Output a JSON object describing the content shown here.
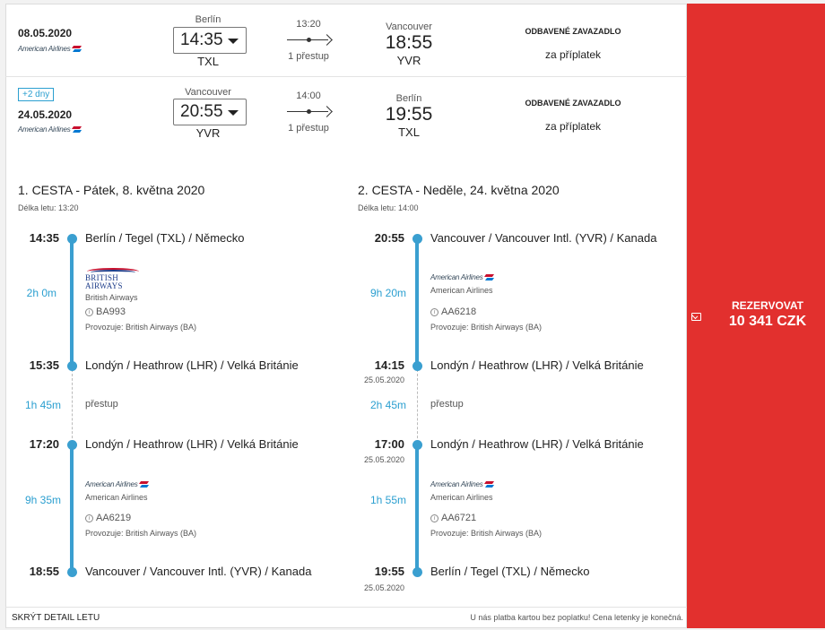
{
  "outbound": {
    "date": "08.05.2020",
    "airline_logo": "American Airlines",
    "from_city": "Berlín",
    "dep_time": "14:35",
    "from_code": "TXL",
    "duration": "13:20",
    "stops": "1 přestup",
    "to_city": "Vancouver",
    "arr_time": "18:55",
    "to_code": "YVR",
    "baggage": "ODBAVENÉ ZAVAZADLO",
    "fee": "za příplatek"
  },
  "inbound": {
    "badge": "+2 dny",
    "date": "24.05.2020",
    "airline_logo": "American Airlines",
    "from_city": "Vancouver",
    "dep_time": "20:55",
    "from_code": "YVR",
    "duration": "14:00",
    "stops": "1 přestup",
    "to_city": "Berlín",
    "arr_time": "19:55",
    "to_code": "TXL",
    "baggage": "ODBAVENÉ ZAVAZADLO",
    "fee": "za příplatek"
  },
  "price": {
    "label": "REZERVOVAT",
    "amount": "10 341 CZK"
  },
  "leg1": {
    "title": "1. CESTA - Pátek, 8. května 2020",
    "length": "Délka letu: 13:20",
    "stops": [
      {
        "time": "14:35",
        "place": "Berlín / Tegel (TXL) / Německo"
      },
      {
        "time": "15:35",
        "place": "Londýn / Heathrow (LHR) / Velká Británie"
      },
      {
        "time": "17:20",
        "place": "Londýn / Heathrow (LHR) / Velká Británie"
      },
      {
        "time": "18:55",
        "place": "Vancouver / Vancouver Intl. (YVR) / Kanada"
      }
    ],
    "seg1": {
      "duration": "2h 0m",
      "logo_line1": "BRITISH",
      "logo_line2": "AIRWAYS",
      "carrier": "British Airways",
      "flight": "BA993",
      "operated": "Provozuje: British Airways (BA)"
    },
    "transfer": {
      "duration": "1h 45m",
      "label": "přestup"
    },
    "seg2": {
      "duration": "9h 35m",
      "logo": "American Airlines",
      "carrier": "American Airlines",
      "flight": "AA6219",
      "operated": "Provozuje: British Airways (BA)"
    }
  },
  "leg2": {
    "title": "2. CESTA - Neděle, 24. května 2020",
    "length": "Délka letu: 14:00",
    "stops": [
      {
        "time": "20:55",
        "place": "Vancouver / Vancouver Intl. (YVR) / Kanada",
        "date": ""
      },
      {
        "time": "14:15",
        "place": "Londýn / Heathrow (LHR) / Velká Británie",
        "date": "25.05.2020"
      },
      {
        "time": "17:00",
        "place": "Londýn / Heathrow (LHR) / Velká Británie",
        "date": "25.05.2020"
      },
      {
        "time": "19:55",
        "place": "Berlín / Tegel (TXL) / Německo",
        "date": "25.05.2020"
      }
    ],
    "seg1": {
      "duration": "9h 20m",
      "logo": "American Airlines",
      "carrier": "American Airlines",
      "flight": "AA6218",
      "operated": "Provozuje: British Airways (BA)"
    },
    "transfer": {
      "duration": "2h 45m",
      "label": "přestup"
    },
    "seg2": {
      "duration": "1h 55m",
      "logo": "American Airlines",
      "carrier": "American Airlines",
      "flight": "AA6721",
      "operated": "Provozuje: British Airways (BA)"
    }
  },
  "footer": {
    "hide": "SKRÝT DETAIL LETU",
    "note": "U nás platba kartou bez poplatku! Cena letenky je konečná."
  },
  "colors": {
    "accent_red": "#e2302e",
    "timeline_blue": "#3a9fd0"
  }
}
